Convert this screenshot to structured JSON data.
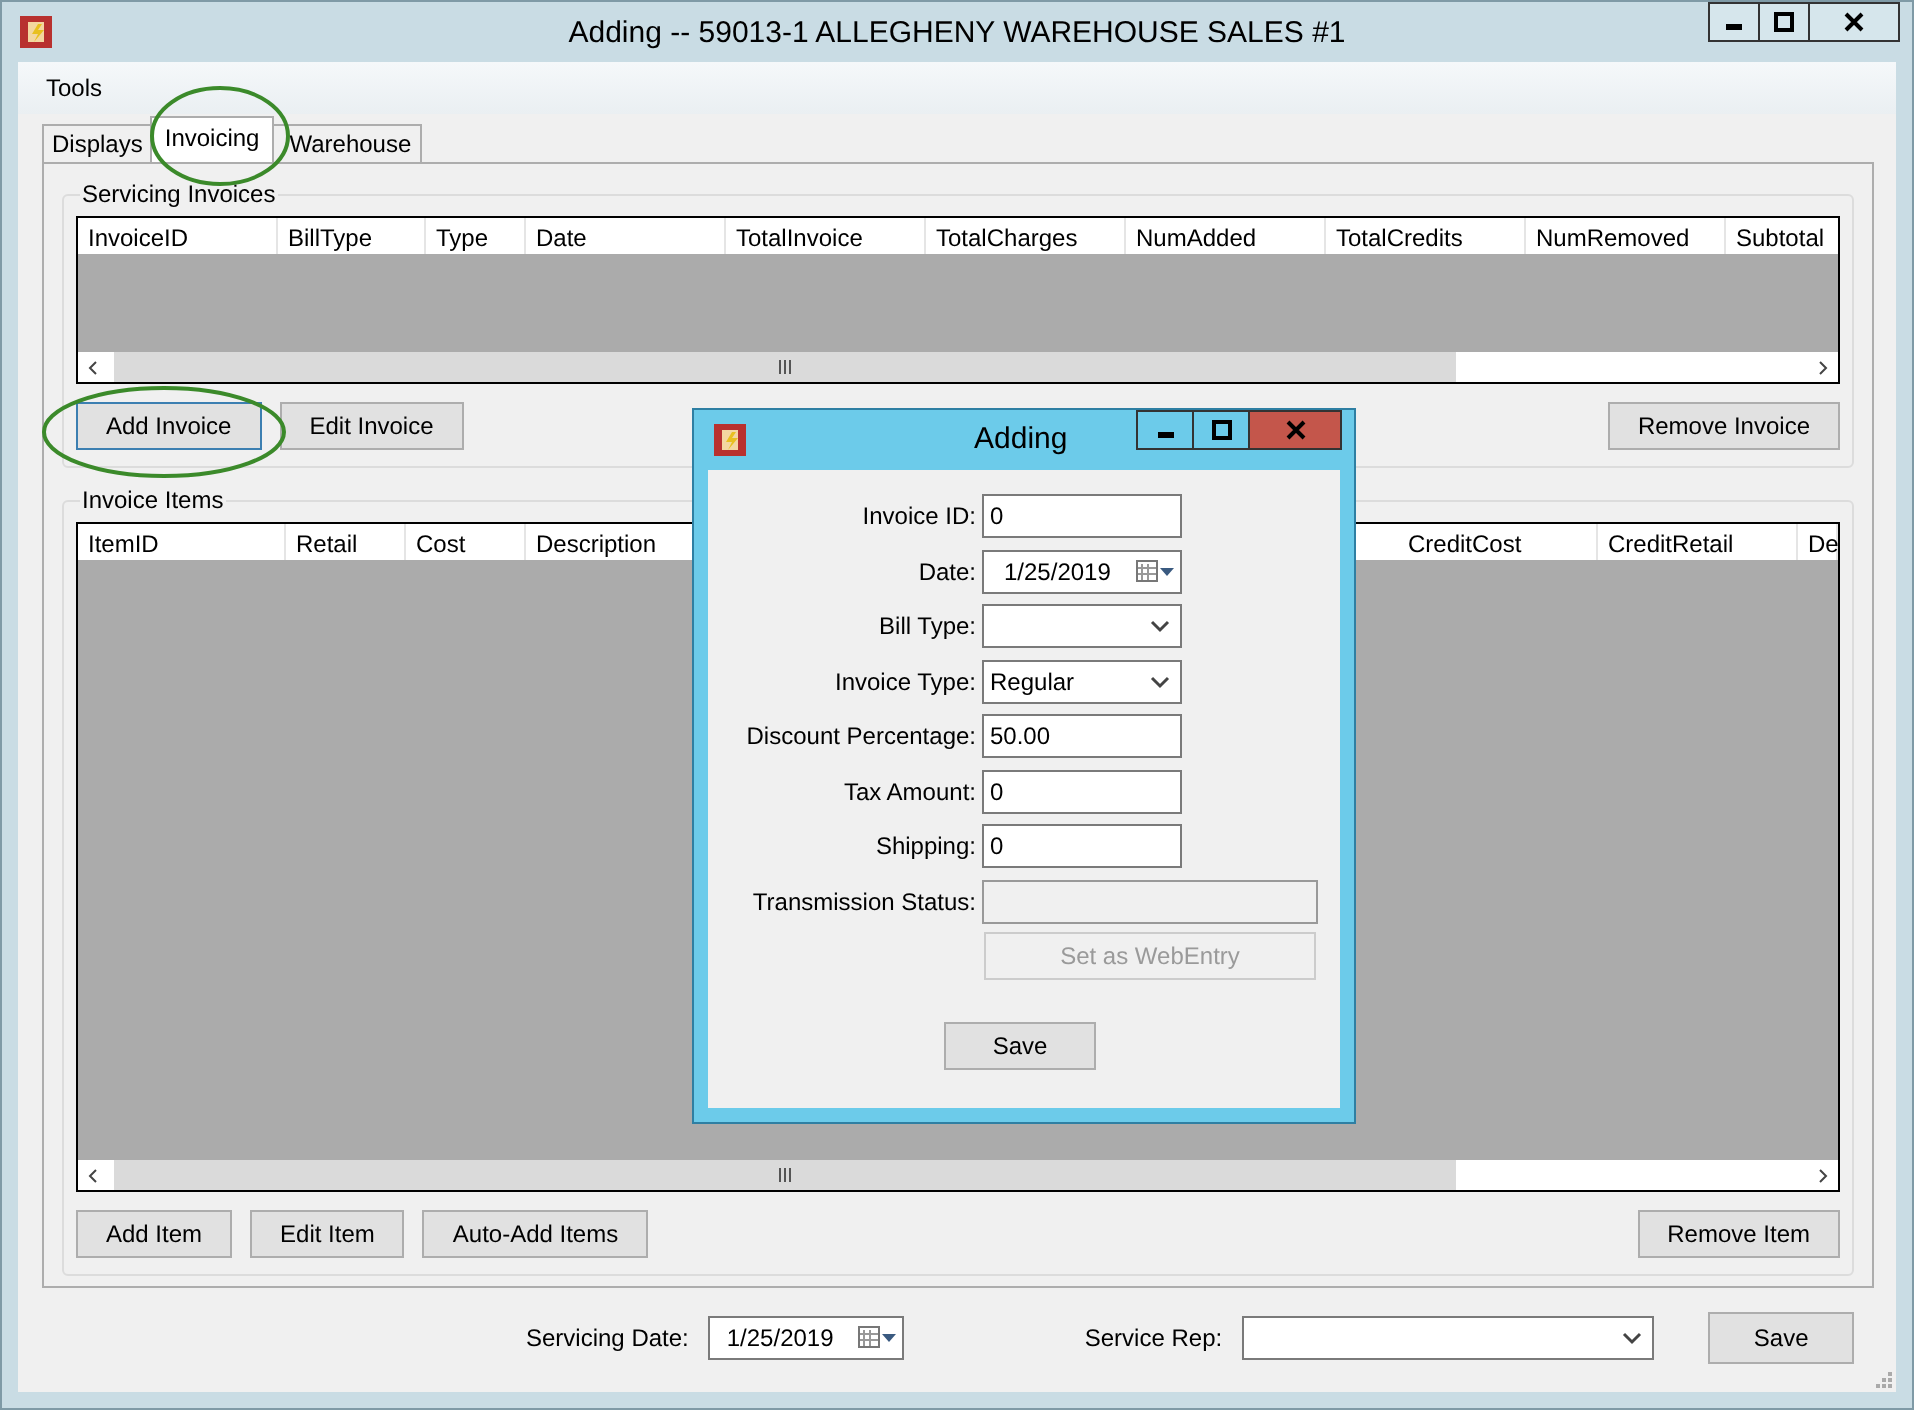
{
  "window": {
    "title": "Adding -- 59013-1 ALLEGHENY WAREHOUSE SALES #1"
  },
  "menu": [
    "Tools"
  ],
  "tabs": [
    {
      "label": "Displays",
      "selected": false
    },
    {
      "label": "Invoicing",
      "selected": true
    },
    {
      "label": "Warehouse",
      "selected": false
    }
  ],
  "servicing_invoices": {
    "title": "Servicing Invoices",
    "columns": [
      "InvoiceID",
      "BillType",
      "Type",
      "Date",
      "TotalInvoice",
      "TotalCharges",
      "NumAdded",
      "TotalCredits",
      "NumRemoved",
      "Subtotal"
    ],
    "left_buttons": [
      "Add Invoice",
      "Edit Invoice"
    ],
    "right_buttons": [
      "Remove Invoice"
    ]
  },
  "invoice_items": {
    "title": "Invoice Items",
    "columns_left": [
      "ItemID",
      "Retail",
      "Cost",
      "Description"
    ],
    "columns_right": [
      "CreditCost",
      "CreditRetail",
      "De"
    ],
    "left_buttons": [
      "Add Item",
      "Edit Item",
      "Auto-Add Items"
    ],
    "right_buttons": [
      "Remove Item"
    ]
  },
  "footer": {
    "date_label": "Servicing Date:",
    "date": "1/25/2019",
    "rep_label": "Service Rep:",
    "save": "Save"
  },
  "dialog": {
    "title": "Adding",
    "fields": [
      {
        "label": "Invoice ID:",
        "kind": "text",
        "value": "0"
      },
      {
        "label": "Date:",
        "kind": "date",
        "value": "1/25/2019"
      },
      {
        "label": "Bill Type:",
        "kind": "select"
      },
      {
        "label": "Invoice Type:",
        "kind": "select",
        "value": "Regular"
      },
      {
        "label": "Discount Percentage:",
        "kind": "text",
        "value": "50.00"
      },
      {
        "label": "Tax Amount:",
        "kind": "text",
        "value": "0"
      },
      {
        "label": "Shipping:",
        "kind": "text",
        "value": "0"
      },
      {
        "label": "Transmission Status:",
        "kind": "readonly"
      }
    ],
    "action": {
      "label": "Set as WebEntry",
      "disabled": true
    },
    "save": "Save"
  }
}
